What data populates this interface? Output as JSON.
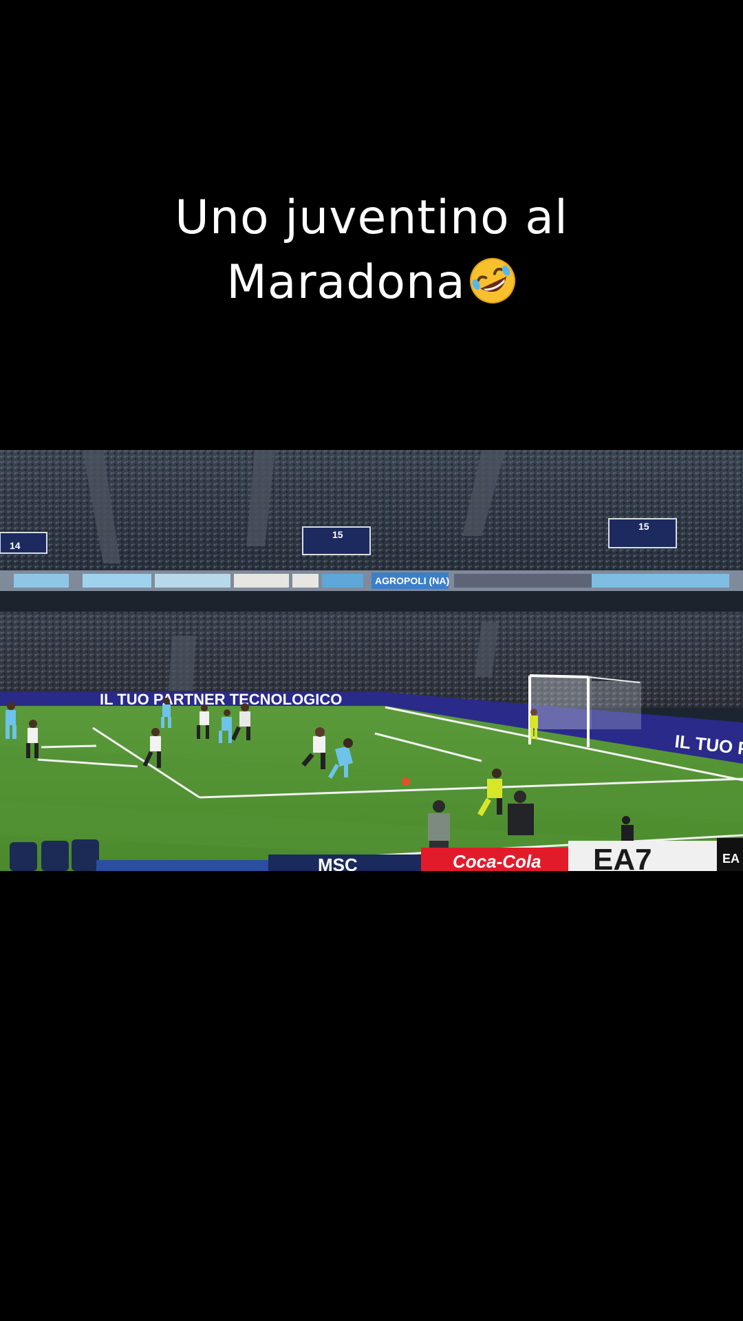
{
  "caption": {
    "line1": "Uno juventino al",
    "line2": "Maradona",
    "emoji_icon": "rolling-on-floor-laughing-emoji"
  },
  "video": {
    "description_icon": "football-match-scene",
    "stand_numbers": [
      "14",
      "15",
      "15"
    ],
    "upper_board_sponsor": "AGROPOLI (NA)",
    "led_board_text": "IL TUO PARTNER TECNOLOGICO",
    "led_board_text_right": "IL TUO PAR",
    "bottom_ads": [
      "MSC",
      "Coca-Cola",
      "EA7",
      "EA"
    ],
    "colors": {
      "pitch_light": "#5f9a3b",
      "pitch_dark": "#4f8a30",
      "led_board": "#2a2a8a",
      "napoli_kit": "#6ec3ea",
      "referee_kit": "#d8e62a"
    }
  }
}
